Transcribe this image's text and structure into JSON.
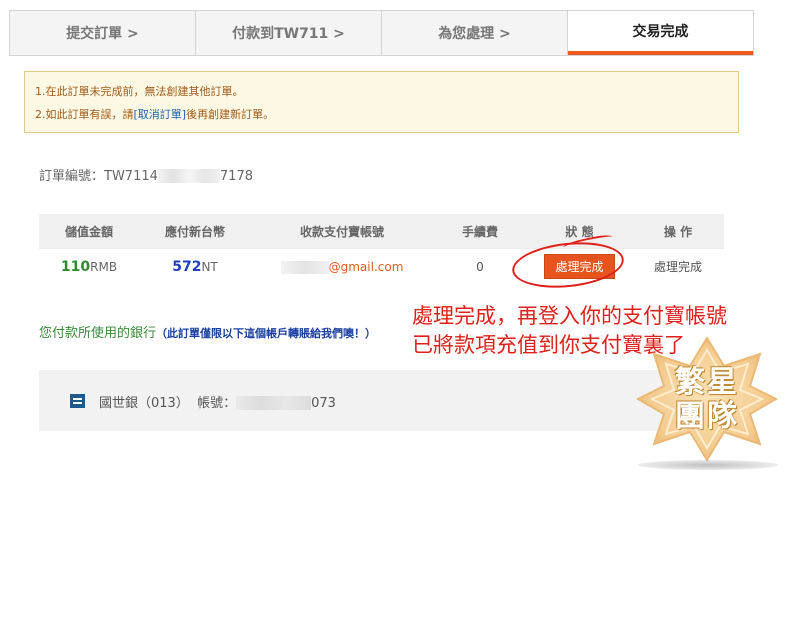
{
  "steps": [
    {
      "label": "提交訂單 >"
    },
    {
      "label": "付款到TW711 >"
    },
    {
      "label": "為您處理 >"
    },
    {
      "label": "交易完成"
    }
  ],
  "notice": {
    "line1": "1.在此訂單未完成前，無法創建其他訂單。",
    "line2_prefix": "2.如此訂單有誤，請",
    "line2_link": "[取消訂單]",
    "line2_suffix": "後再創建新訂單。"
  },
  "order": {
    "label": "訂單編號：",
    "prefix": "TW7114",
    "suffix": "7178"
  },
  "table": {
    "headers": [
      "儲值金額",
      "應付新台幣",
      "收款支付寶帳號",
      "手續費",
      "狀 態",
      "操 作"
    ],
    "row": {
      "amount_value": "110",
      "amount_unit": "RMB",
      "pay_value": "572",
      "pay_unit": "NT",
      "email_suffix": "@gmail.com",
      "fee": "0",
      "status": "處理完成",
      "action": "處理完成"
    }
  },
  "bank_note": {
    "main": "您付款所使用的銀行",
    "sub": "（此訂單僅限以下這個帳戶轉賬給我們噢！）"
  },
  "bank": {
    "name": "國世銀（013）",
    "account_label": "帳號：",
    "account_suffix": "073"
  },
  "annotation": {
    "line1": "處理完成，再登入你的支付寶帳號",
    "line2": "已將款項充值到你支付寶裏了"
  },
  "watermark": {
    "line1": "繁星",
    "line2": "團隊"
  },
  "colors": {
    "accent": "#ef5a1f",
    "annotation": "#e0201a",
    "green": "#2e8b2e",
    "blue": "#1f3fbf"
  }
}
